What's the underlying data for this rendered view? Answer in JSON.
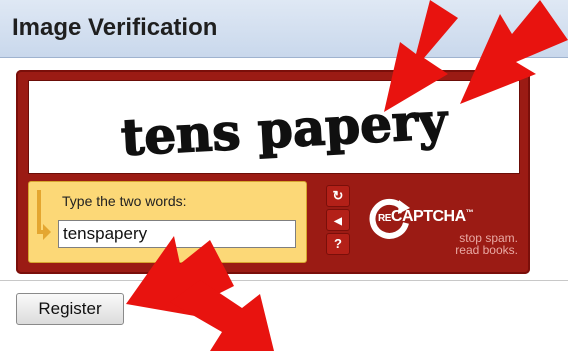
{
  "header": {
    "title": "Image Verification"
  },
  "captcha": {
    "challenge_words": "tens papery",
    "prompt_label": "Type the two words:",
    "input_value": "tenspapery",
    "controls": [
      {
        "name": "reload-icon",
        "glyph": "↻"
      },
      {
        "name": "audio-icon",
        "glyph": "◀"
      },
      {
        "name": "help-icon",
        "glyph": "?"
      }
    ],
    "brand": {
      "name": "CAPTCHA",
      "prefix": "RE",
      "tagline_line1": "stop spam.",
      "tagline_line2": "read books."
    },
    "colors": {
      "frame": "#9b1b14",
      "input_panel": "#fcd877"
    }
  },
  "form": {
    "register_label": "Register"
  },
  "annotations": {
    "arrow_color": "#e8130f"
  }
}
